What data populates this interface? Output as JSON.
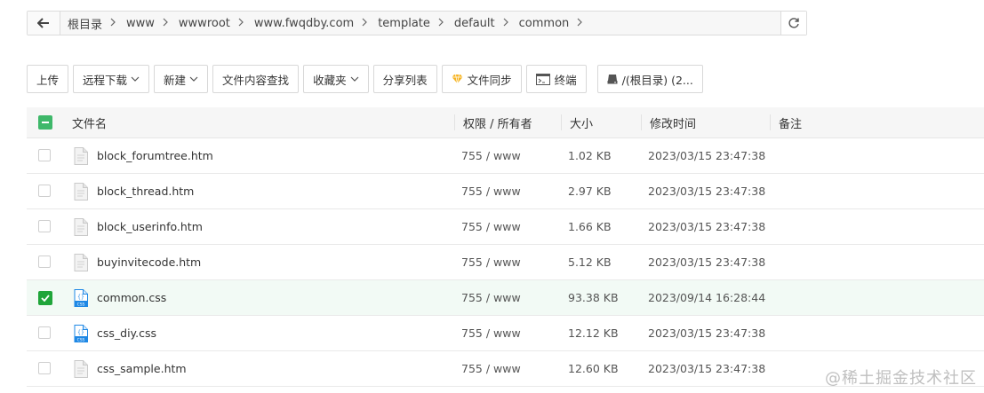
{
  "breadcrumbs": [
    "根目录",
    "www",
    "wwwroot",
    "www.fwqdby.com",
    "template",
    "default",
    "common"
  ],
  "toolbar": {
    "upload": "上传",
    "remote_download": "远程下载",
    "new": "新建",
    "search_content": "文件内容查找",
    "favorites": "收藏夹",
    "share_list": "分享列表",
    "file_sync": "文件同步",
    "terminal": "终端",
    "disk": "/(根目录) (2..."
  },
  "table": {
    "headers": {
      "name": "文件名",
      "permission": "权限 / 所有者",
      "size": "大小",
      "mtime": "修改时间",
      "note": "备注"
    },
    "rows": [
      {
        "name": "block_forumtree.htm",
        "perm": "755 / www",
        "size": "1.02 KB",
        "mtime": "2023/03/15 23:47:38",
        "type": "htm",
        "checked": false
      },
      {
        "name": "block_thread.htm",
        "perm": "755 / www",
        "size": "2.97 KB",
        "mtime": "2023/03/15 23:47:38",
        "type": "htm",
        "checked": false
      },
      {
        "name": "block_userinfo.htm",
        "perm": "755 / www",
        "size": "1.66 KB",
        "mtime": "2023/03/15 23:47:38",
        "type": "htm",
        "checked": false
      },
      {
        "name": "buyinvitecode.htm",
        "perm": "755 / www",
        "size": "5.12 KB",
        "mtime": "2023/03/15 23:47:38",
        "type": "htm",
        "checked": false
      },
      {
        "name": "common.css",
        "perm": "755 / www",
        "size": "93.38 KB",
        "mtime": "2023/09/14 16:28:44",
        "type": "css",
        "checked": true
      },
      {
        "name": "css_diy.css",
        "perm": "755 / www",
        "size": "12.12 KB",
        "mtime": "2023/03/15 23:47:38",
        "type": "css",
        "checked": false
      },
      {
        "name": "css_sample.htm",
        "perm": "755 / www",
        "size": "12.60 KB",
        "mtime": "2023/03/15 23:47:38",
        "type": "htm",
        "checked": false
      }
    ]
  },
  "watermark": "@稀土掘金技术社区",
  "colors": {
    "accent": "#20a53a",
    "css_icon": "#1e88e5"
  }
}
